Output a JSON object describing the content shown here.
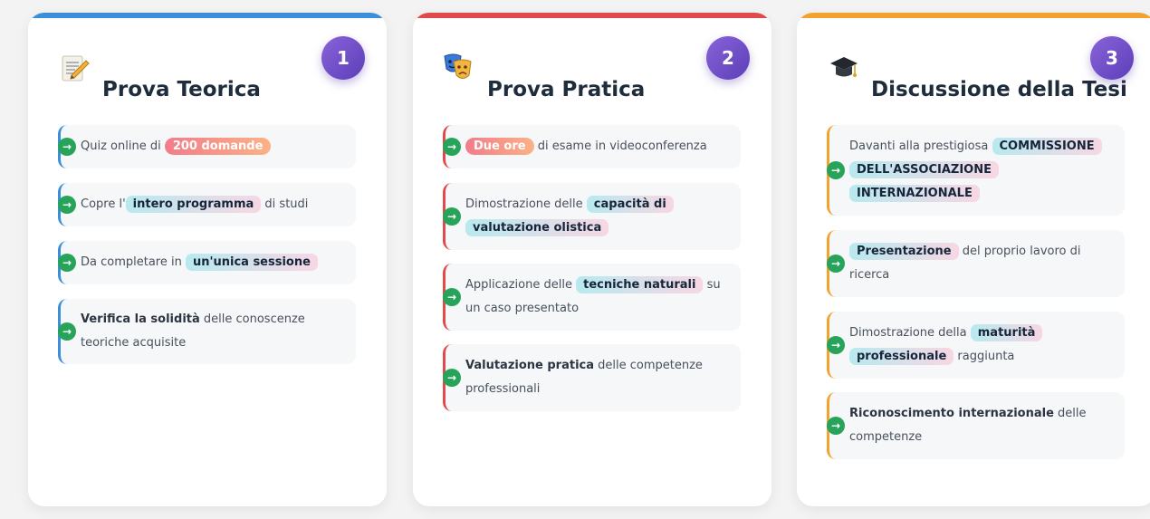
{
  "colors": {
    "card1_accent": "#3b8fd9",
    "card2_accent": "#e04a4a",
    "card3_accent": "#f2a22f",
    "arrow": "#27a35a"
  },
  "cards": [
    {
      "number": "1",
      "icon": "memo-pencil-icon",
      "title": "Prova Teorica",
      "items": [
        {
          "pre": "Quiz online di ",
          "hl": "200 domande",
          "post": ""
        },
        {
          "pre": "Copre l'",
          "hl": "intero programma",
          "post": " di studi"
        },
        {
          "pre": "Da completare in ",
          "hl": "un'unica sessione",
          "post": ""
        },
        {
          "bold": "Verifica la solidità",
          "post": " delle conoscenze teoriche acquisite"
        }
      ]
    },
    {
      "number": "2",
      "icon": "theater-masks-icon",
      "title": "Prova Pratica",
      "items": [
        {
          "hl": "Due ore",
          "post": " di esame in videoconferenza"
        },
        {
          "pre": "Dimostrazione delle ",
          "hl": "capacità di valutazione olistica",
          "post": ""
        },
        {
          "pre": "Applicazione delle ",
          "hl": "tecniche naturali",
          "post": " su un caso presentato"
        },
        {
          "bold": "Valutazione pratica",
          "post": " delle competenze professionali"
        }
      ]
    },
    {
      "number": "3",
      "icon": "graduation-cap-icon",
      "title": "Discussione della Tesi",
      "items": [
        {
          "pre": "Davanti alla prestigiosa ",
          "hl": "COMMISSIONE DELL'ASSOCIAZIONE INTERNAZIONALE",
          "post": ""
        },
        {
          "hl": "Presentazione",
          "post": " del proprio lavoro di ricerca"
        },
        {
          "pre": "Dimostrazione della ",
          "hl": "maturità professionale",
          "post": " raggiunta"
        },
        {
          "bold": "Riconoscimento internazionale",
          "post": " delle competenze"
        }
      ]
    }
  ]
}
